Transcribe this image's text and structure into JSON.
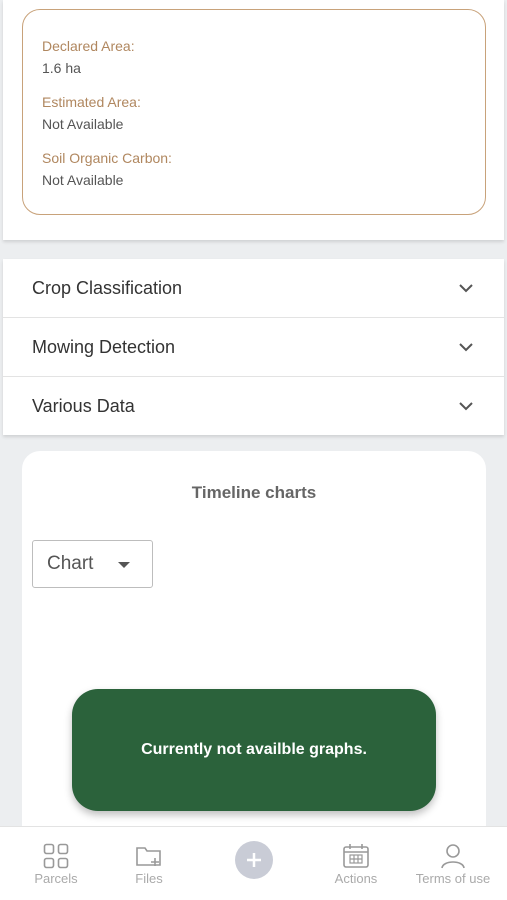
{
  "info": {
    "declared_area_label": "Declared Area:",
    "declared_area_value": "1.6 ha",
    "estimated_area_label": "Estimated Area:",
    "estimated_area_value": "Not Available",
    "soc_label": "Soil Organic Carbon:",
    "soc_value": "Not Available"
  },
  "accordion": {
    "items": [
      {
        "label": "Crop Classification"
      },
      {
        "label": "Mowing Detection"
      },
      {
        "label": "Various Data"
      }
    ]
  },
  "chart_card": {
    "title": "Timeline charts",
    "select_value": "Chart"
  },
  "toast": {
    "message": "Currently not availble graphs."
  },
  "nav": {
    "parcels": "Parcels",
    "files": "Files",
    "actions": "Actions",
    "terms": "Terms of use"
  },
  "colors": {
    "info_border": "#c8a27a",
    "info_label": "#b0875f",
    "toast_bg": "#2b623b",
    "fab_bg": "#c9ccd6"
  },
  "icons": [
    "chevron-down-icon",
    "grid-icon",
    "folder-add-icon",
    "plus-icon",
    "calendar-icon",
    "user-icon"
  ]
}
